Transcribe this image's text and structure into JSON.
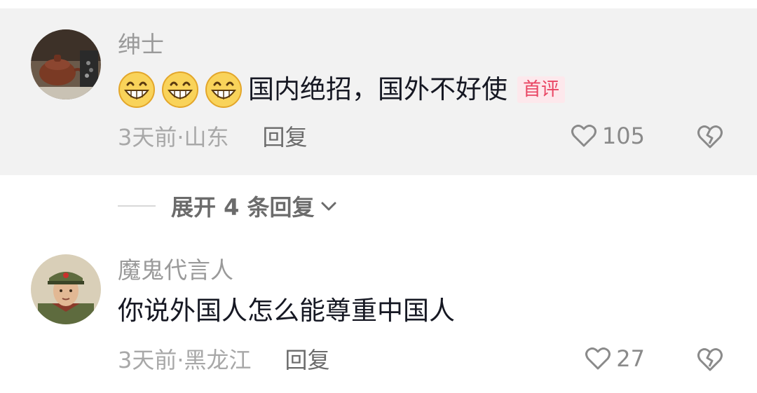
{
  "comments": [
    {
      "username": "绅士",
      "emoji_icons": [
        "grinning-face-icon",
        "grinning-face-icon",
        "grinning-face-icon"
      ],
      "text": "国内绝招，国外不好使",
      "badge": "首评",
      "time_location": "3天前·山东",
      "reply_label": "回复",
      "like_count": "105",
      "avatar": "teapot-photo-avatar"
    },
    {
      "username": "魔鬼代言人",
      "text": "你说外国人怎么能尊重中国人",
      "time_location": "3天前·黑龙江",
      "reply_label": "回复",
      "like_count": "27",
      "avatar": "soldier-portrait-avatar"
    }
  ],
  "expand_replies": {
    "label": "展开 4 条回复"
  },
  "icons": {
    "like": "heart-outline-icon",
    "dislike": "broken-heart-icon",
    "expand": "chevron-down-icon"
  },
  "colors": {
    "highlight_bg": "#f2f2f2",
    "badge_bg": "#fde8ec",
    "badge_text": "#e94563",
    "text_primary": "#161823",
    "text_secondary": "#9a9a9a"
  }
}
